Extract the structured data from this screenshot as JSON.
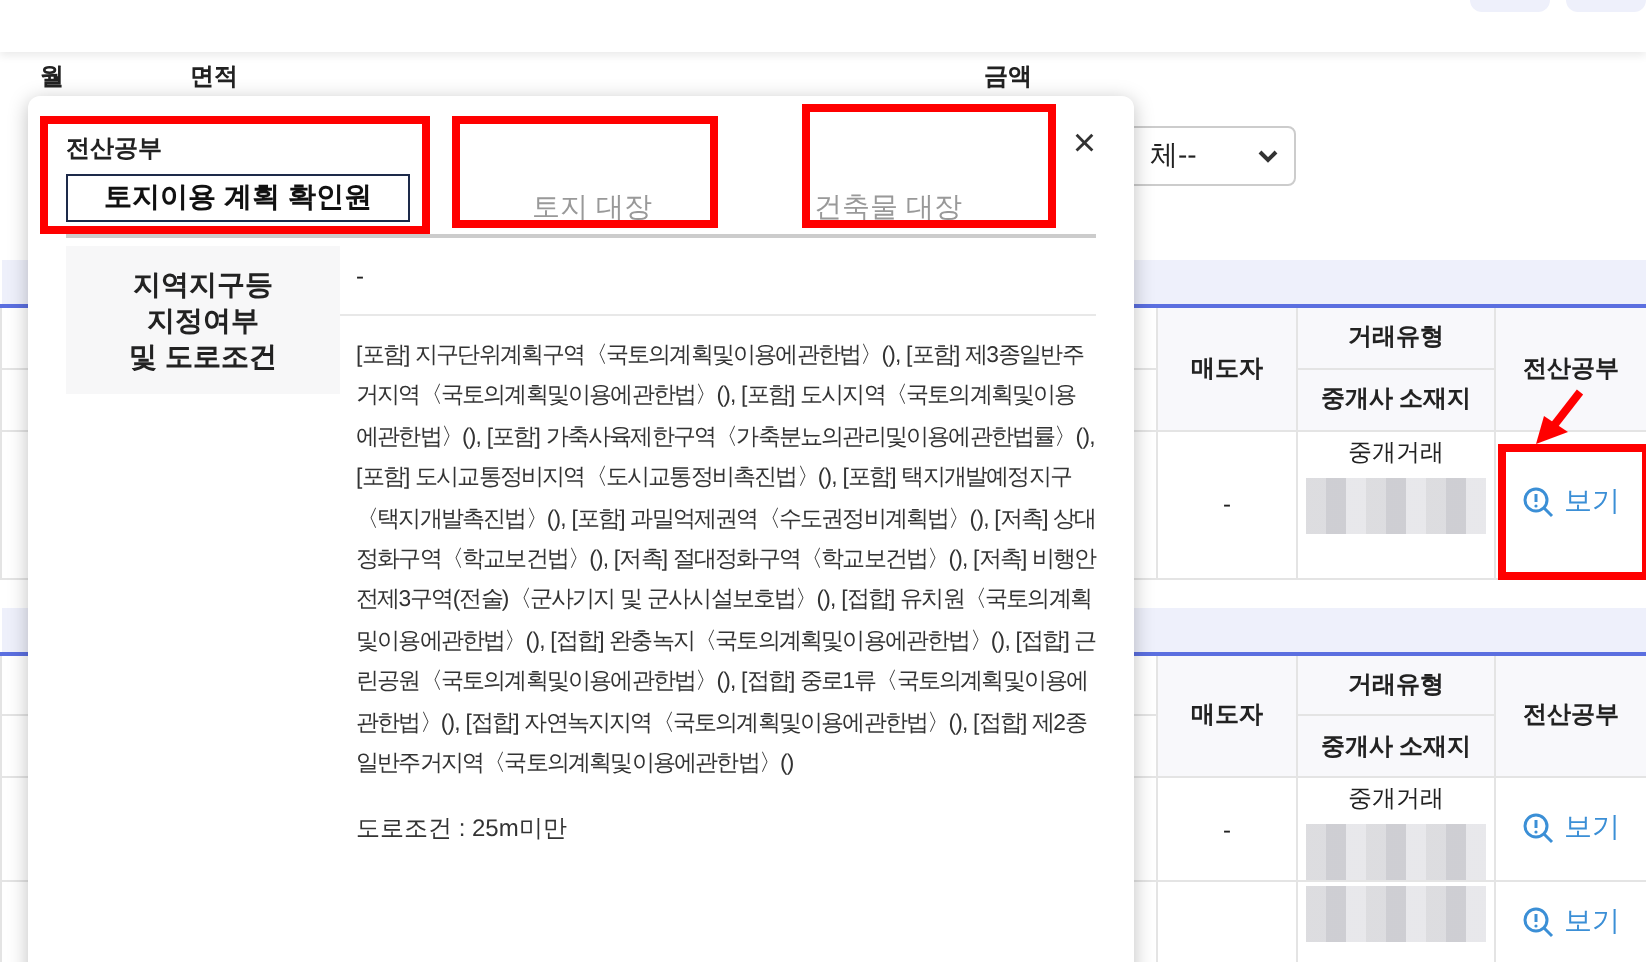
{
  "filters": [
    {
      "label": "월"
    },
    {
      "label": "면적"
    },
    {
      "label": "금액"
    }
  ],
  "select": {
    "value": "체--"
  },
  "tables": [
    {
      "headers": {
        "seller": "매도자",
        "trade_type": "거래유형",
        "broker_location": "중개사 소재지",
        "documents": "전산공부"
      },
      "rows": [
        {
          "seller": "-",
          "trade_type": "중개거래",
          "link": "보기"
        }
      ]
    },
    {
      "headers": {
        "seller": "매도자",
        "trade_type": "거래유형",
        "broker_location": "중개사 소재지",
        "documents": "전산공부"
      },
      "rows": [
        {
          "seller": "-",
          "trade_type": "중개거래",
          "link": "보기"
        },
        {
          "link": "보기"
        }
      ]
    }
  ],
  "modal": {
    "heading": "전산공부",
    "close": "×",
    "tabs": [
      {
        "label": "토지이용 계획 확인원",
        "selected": true
      },
      {
        "label": "토지 대장",
        "selected": false
      },
      {
        "label": "건축물 대장",
        "selected": false
      }
    ],
    "section": {
      "label_lines": [
        "지역지구등",
        "지정여부",
        "및 도로조건"
      ],
      "summary": "-",
      "text": "[포함] 지구단위계획구역〈국토의계획및이용에관한법〉(), [포함] 제3종일반주거지역〈국토의계획및이용에관한법〉(), [포함] 도시지역〈국토의계획및이용에관한법〉(), [포함] 가축사육제한구역〈가축분뇨의관리및이용에관한법률〉(), [포함] 도시교통정비지역〈도시교통정비촉진법〉(), [포함] 택지개발예정지구〈택지개발촉진법〉(), [포함] 과밀억제권역〈수도권정비계획법〉(), [저촉] 상대정화구역〈학교보건법〉(), [저촉] 절대정화구역〈학교보건법〉(), [저촉] 비행안전제3구역(전술)〈군사기지 및 군사시설보호법〉(), [접합] 유치원〈국토의계획및이용에관한법〉(), [접합] 완충녹지〈국토의계획및이용에관한법〉(), [접합] 근린공원〈국토의계획및이용에관한법〉(), [접합] 중로1류〈국토의계획및이용에관한법〉(), [접합] 자연녹지지역〈국토의계획및이용에관한법〉(), [접합] 제2종일반주거지역〈국토의계획및이용에관한법〉()",
      "road": "도로조건 : 25m미만"
    }
  }
}
